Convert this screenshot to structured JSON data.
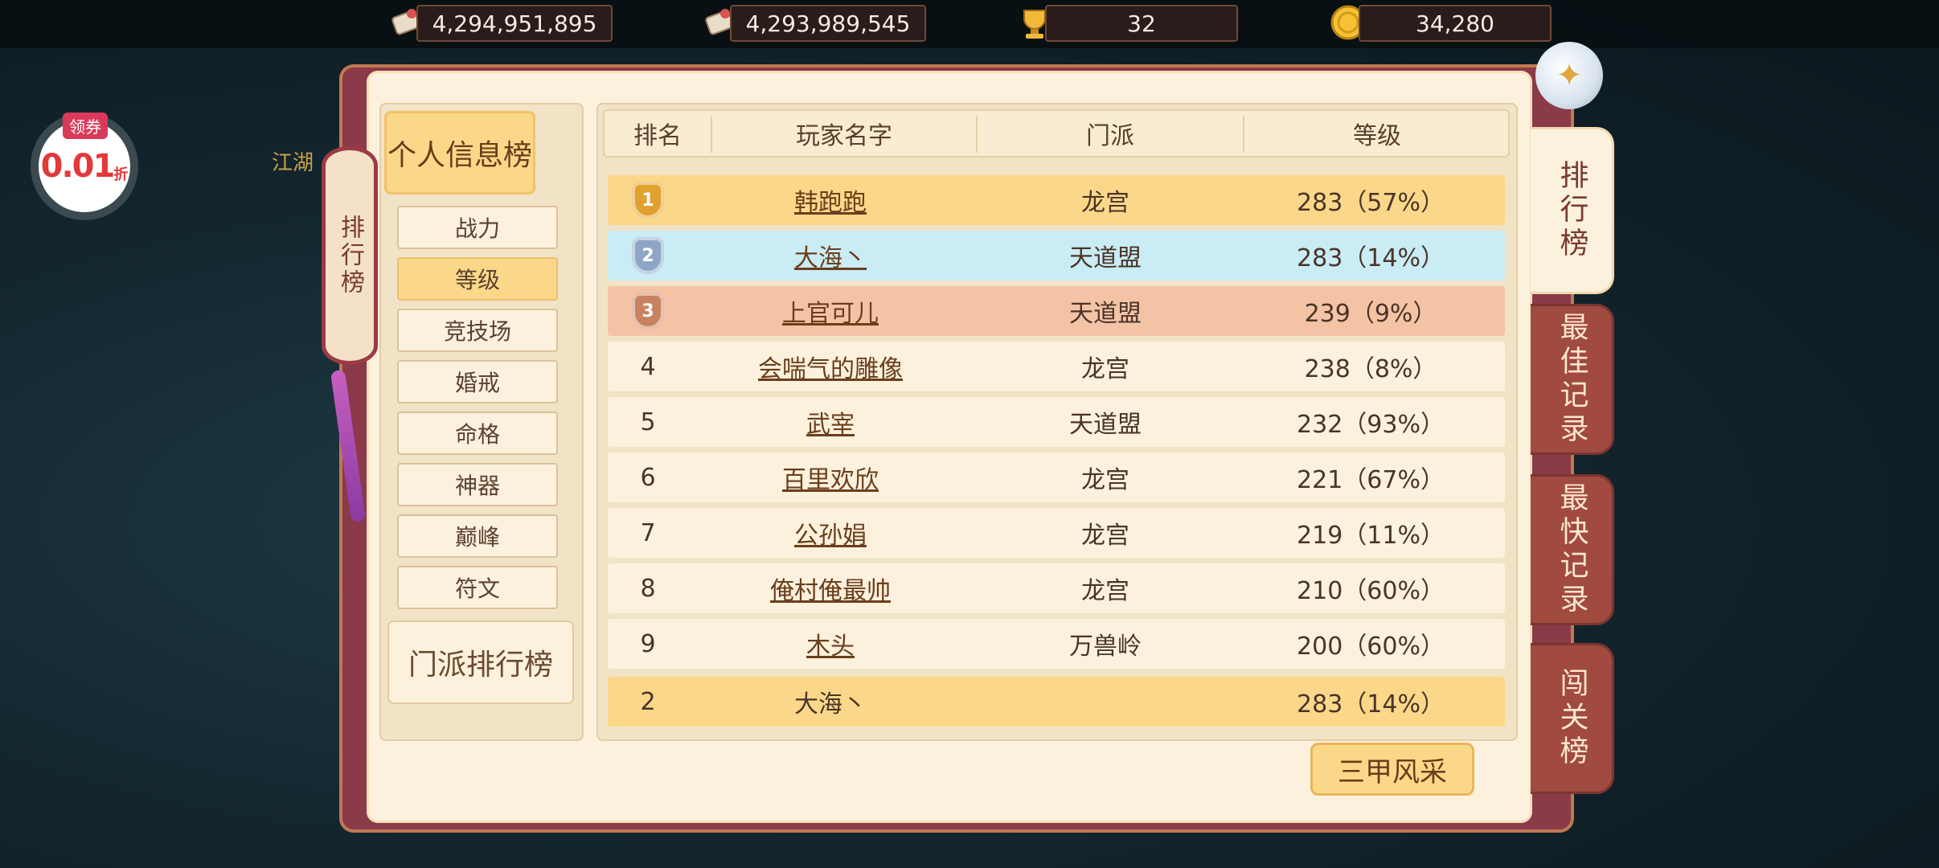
{
  "resources": [
    {
      "icon": "scroll-icon",
      "value": "4,294,951,895"
    },
    {
      "icon": "scroll-icon",
      "value": "4,293,989,545"
    },
    {
      "icon": "trophy-icon",
      "value": "32"
    },
    {
      "icon": "gold-coin-icon",
      "value": "34,280"
    }
  ],
  "coupon": {
    "tag": "领券",
    "value": "0.01",
    "unit": "折"
  },
  "background_text": "江湖",
  "banner_title": "排行榜",
  "left_panel": {
    "personal_category": "个人信息榜",
    "sub_items": [
      "战力",
      "等级",
      "竞技场",
      "婚戒",
      "命格",
      "神器",
      "巅峰",
      "符文"
    ],
    "active_sub": "等级",
    "sect_category": "门派排行榜"
  },
  "table": {
    "headers": {
      "rank": "排名",
      "name": "玩家名字",
      "sect": "门派",
      "level": "等级"
    },
    "rows": [
      {
        "rank": "1",
        "name": "韩跑跑",
        "sect": "龙宫",
        "level": "283（57%）"
      },
      {
        "rank": "2",
        "name": "大海丶",
        "sect": "天道盟",
        "level": "283（14%）"
      },
      {
        "rank": "3",
        "name": "上官可儿",
        "sect": "天道盟",
        "level": "239（9%）"
      },
      {
        "rank": "4",
        "name": "会喘气的雕像",
        "sect": "龙宫",
        "level": "238（8%）"
      },
      {
        "rank": "5",
        "name": "武宰",
        "sect": "天道盟",
        "level": "232（93%）"
      },
      {
        "rank": "6",
        "name": "百里欢欣",
        "sect": "龙宫",
        "level": "221（67%）"
      },
      {
        "rank": "7",
        "name": "公孙娟",
        "sect": "龙宫",
        "level": "219（11%）"
      },
      {
        "rank": "8",
        "name": "俺村俺最帅",
        "sect": "龙宫",
        "level": "210（60%）"
      },
      {
        "rank": "9",
        "name": "木头",
        "sect": "万兽岭",
        "level": "200（60%）"
      }
    ],
    "my_row": {
      "rank": "2",
      "name": "大海丶",
      "sect": "",
      "level": "283（14%）"
    }
  },
  "sanjia_button": "三甲风采",
  "right_tabs": [
    "排行榜",
    "最佳记录",
    "最快记录",
    "闯关榜"
  ],
  "colors": {
    "gold_row": "#fbd889",
    "silver_row": "#c9ecf5",
    "bronze_row": "#f4c3a6",
    "normal_row": "#fbf1dd",
    "frame": "#8a3a48"
  }
}
